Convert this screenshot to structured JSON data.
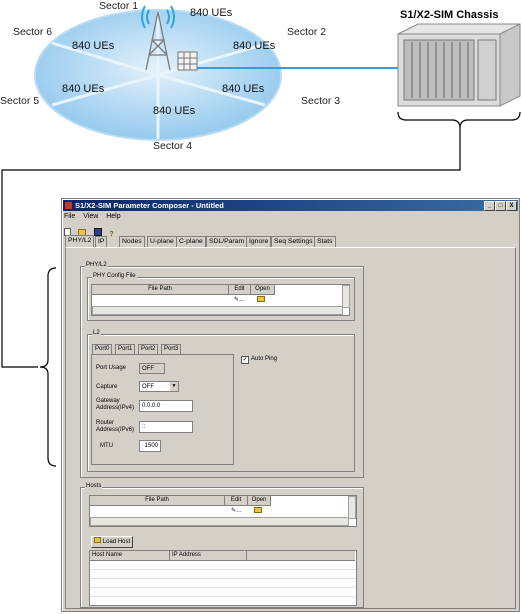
{
  "diagram": {
    "sectors": [
      "Sector 1",
      "Sector 2",
      "Sector 3",
      "Sector 4",
      "Sector 5",
      "Sector 6"
    ],
    "ue_label": "840 UEs",
    "chassis_title": "S1/X2-SIM Chassis",
    "colors": {
      "cell": "#8ec6ec",
      "cell_light": "#c9e4f7",
      "link": "#3a9bd8"
    }
  },
  "window": {
    "title": "S1/X2-SIM Parameter Composer - Untitled",
    "controls": [
      "_",
      "□",
      "X"
    ],
    "menu": [
      "File",
      "View",
      "Help"
    ],
    "toolbar_icons": [
      "new-file-icon",
      "open-folder-icon",
      "save-disk-icon",
      "help-icon"
    ],
    "tabs": [
      "PHY/L2",
      "IP",
      "Nodes",
      "U-plane",
      "C-plane",
      "SDL/Param",
      "Ignore",
      "Seq Settings",
      "Stats"
    ],
    "active_tab": "PHY/L2"
  },
  "phyl2": {
    "group_title": "PHY/L2",
    "config_file": {
      "group_title": "PHY Config File",
      "columns": [
        "File Path",
        "Edit",
        "Open"
      ]
    },
    "l2": {
      "group_title": "L2",
      "ports": [
        "Port0",
        "Port1",
        "Port2",
        "Port3"
      ],
      "active_port": "Port0",
      "port_usage_label": "Port Usage",
      "port_usage_value": "OFF",
      "capture_label": "Capture",
      "capture_value": "OFF",
      "gateway_label_1": "Gateway",
      "gateway_label_2": "Address(IPv4)",
      "gateway_value": "0.0.0.0",
      "router_label_1": "Router",
      "router_label_2": "Address(IPv6)",
      "router_value": "::",
      "mtu_label": "MTU",
      "mtu_value": "1500",
      "auto_ping_label": "Auto Ping",
      "auto_ping_checked": true
    }
  },
  "hosts": {
    "group_title": "Hosts",
    "columns": [
      "File Path",
      "Edit",
      "Open"
    ],
    "load_host_label": "Load Host",
    "table_columns": [
      "Host Name",
      "IP Address"
    ]
  }
}
